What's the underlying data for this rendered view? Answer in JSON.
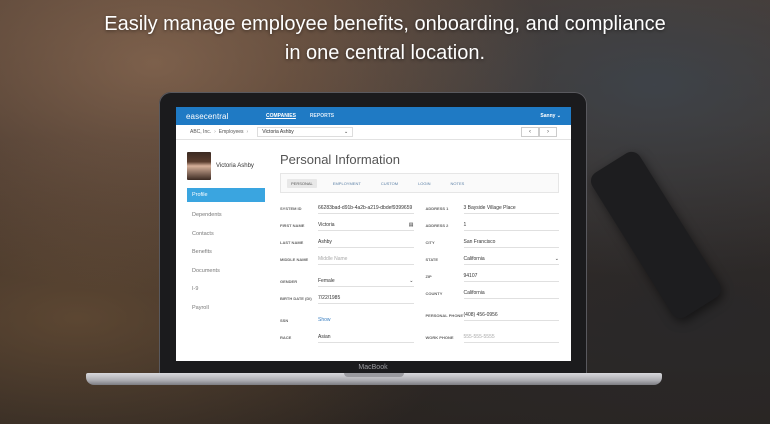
{
  "headline": {
    "line1": "Easily manage employee benefits, onboarding, and compliance",
    "line2": "in one central location."
  },
  "device_label": "MacBook",
  "app": {
    "logo": "easecentral",
    "nav": [
      "COMPANIES",
      "REPORTS"
    ],
    "user": "Sanny ⌄"
  },
  "breadcrumb": {
    "company": "ABC, Inc.",
    "section": "Employees",
    "employee": "Victoria Ashby"
  },
  "profile": {
    "name": "Victoria Ashby"
  },
  "sidebar": [
    "Profile",
    "Dependents",
    "Contacts",
    "Benefits",
    "Documents",
    "I-9",
    "Payroll"
  ],
  "page_title": "Personal Information",
  "tabs": [
    "PERSONAL",
    "EMPLOYMENT",
    "CUSTOM",
    "LOGIN",
    "NOTES"
  ],
  "left_fields": [
    {
      "label": "SYSTEM ID",
      "value": "66283bad-d91b-4a2b-a219-dbdef9399659"
    },
    {
      "label": "FIRST NAME",
      "value": "Victoria"
    },
    {
      "label": "LAST NAME",
      "value": "Ashby"
    },
    {
      "label": "MIDDLE NAME",
      "value": "Middle Name"
    },
    {
      "label": "GENDER",
      "value": "Female"
    },
    {
      "label": "BIRTH DATE (DI)",
      "value": "7/22/1985"
    },
    {
      "label": "SSN",
      "value": "Show"
    },
    {
      "label": "RACE",
      "value": "Asian"
    }
  ],
  "right_fields": [
    {
      "label": "ADDRESS 1",
      "value": "3 Bayside Village Place"
    },
    {
      "label": "ADDRESS 2",
      "value": "1"
    },
    {
      "label": "CITY",
      "value": "San Francisco"
    },
    {
      "label": "STATE",
      "value": "California"
    },
    {
      "label": "ZIP",
      "value": "94107"
    },
    {
      "label": "COUNTY",
      "value": "California"
    },
    {
      "label": "PERSONAL PHONE",
      "value": "(408) 456-0956"
    },
    {
      "label": "WORK PHONE",
      "value": "555-555-5555"
    }
  ],
  "colors": {
    "brand": "#1f7ac4",
    "active_tab": "#3aa5e0"
  }
}
